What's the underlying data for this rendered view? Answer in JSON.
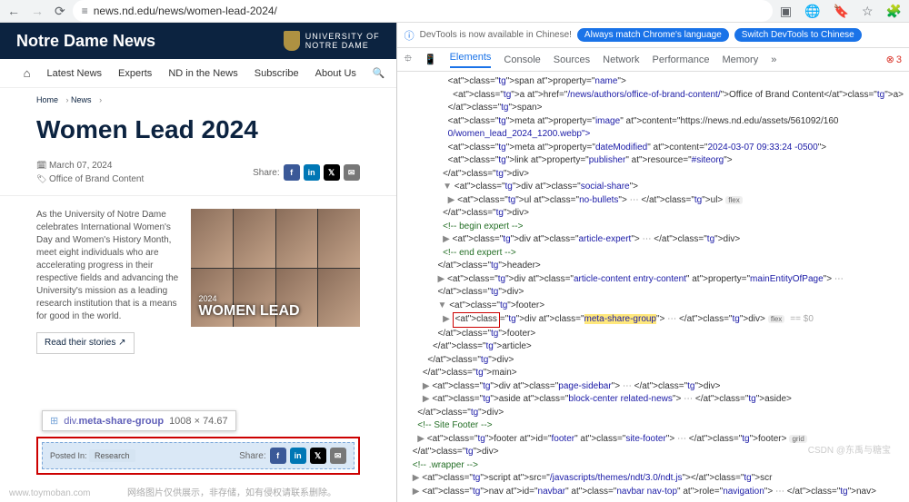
{
  "browser": {
    "url_prefix": "≡",
    "url": "news.nd.edu/news/women-lead-2024/",
    "icons": [
      "chromecast",
      "translate",
      "bookmark",
      "star",
      "ext"
    ]
  },
  "devtools_banner": {
    "info_icon": "ⓘ",
    "info_text": "DevTools is now available in Chinese!",
    "pill1": "Always match Chrome's language",
    "pill2": "Switch DevTools to Chinese"
  },
  "devtools_tabs": {
    "items": [
      "Elements",
      "Console",
      "Sources",
      "Network",
      "Performance",
      "Memory"
    ],
    "more": "»",
    "errors": "3"
  },
  "site": {
    "title": "Notre Dame News",
    "brand_top": "UNIVERSITY OF",
    "brand_bottom": "NOTRE DAME",
    "nav": {
      "home": "⌂",
      "latest": "Latest News",
      "experts": "Experts",
      "ndnews": "ND in the News",
      "subscribe": "Subscribe",
      "about": "About Us",
      "search": "🔍"
    }
  },
  "breadcrumb": {
    "home": "Home",
    "sep1": "›",
    "news": "News",
    "sep2": "›"
  },
  "article": {
    "title": "Women Lead 2024",
    "date": "March 07, 2024",
    "author": "Office of Brand Content",
    "share_label": "Share:",
    "share_icons": {
      "fb": "f",
      "li": "in",
      "x": "𝕏",
      "em": "✉"
    },
    "intro": "As the University of Notre Dame celebrates International Women's Day and Women's History Month, meet eight individuals who are accelerating progress in their respective fields and advancing the University's mission as a leading research institution that is a means for good in the world.",
    "read_btn": "Read their stories ↗",
    "hero_year": "2024",
    "hero_text": "WOMEN LEAD"
  },
  "tooltip": {
    "icon": "⊞",
    "selector_prefix": "div.",
    "selector_class": "meta-share-group",
    "dims": "1008 × 74.67"
  },
  "highlight": {
    "posted_label": "Posted In:",
    "tag": "Research",
    "share_label": "Share:"
  },
  "dom_lines": [
    {
      "i": 9,
      "h": "<span property=\"name\">"
    },
    {
      "i": 10,
      "h": "<a href=\"/news/authors/office-of-brand-content/\">Office of Brand Content</a>"
    },
    {
      "i": 9,
      "h": "</span>"
    },
    {
      "i": 9,
      "h": "<meta property=\"image\" content=\"https://news.nd.edu/assets/561092/160"
    },
    {
      "i": 9,
      "raw": "0/women_lead_2024_1200.webp\">"
    },
    {
      "i": 9,
      "h": "<meta property=\"dateModified\" content=\"2024-03-07 09:33:24 -0500\">"
    },
    {
      "i": 9,
      "h": "<link property=\"publisher\" resource=\"#siteorg\">"
    },
    {
      "i": 8,
      "h": "</div>"
    },
    {
      "i": 8,
      "t": "▼",
      "h": "<div class=\"social-share\">"
    },
    {
      "i": 9,
      "t": "▶",
      "h": "<ul class=\"no-bullets\"> ⋯ </ul>",
      "badge": "flex"
    },
    {
      "i": 8,
      "h": "</div>"
    },
    {
      "i": 8,
      "cm": "<!-- begin expert -->"
    },
    {
      "i": 8,
      "t": "▶",
      "h": "<div class=\"article-expert\"> ⋯ </div>"
    },
    {
      "i": 8,
      "cm": "<!-- end expert -->"
    },
    {
      "i": 7,
      "h": "</header>"
    },
    {
      "i": 7,
      "t": "▶",
      "h": "<div class=\"article-content entry-content\" property=\"mainEntityOfPage\"> ⋯"
    },
    {
      "i": 7,
      "h": "</div>"
    },
    {
      "i": 7,
      "t": "▼",
      "h": "<footer>"
    },
    {
      "i": 8,
      "sel": true,
      "t": "▶",
      "h": "<div class=\"meta-share-group\"> ⋯ </div>",
      "badge": "flex",
      "dollar": "== $0"
    },
    {
      "i": 7,
      "h": "</footer>"
    },
    {
      "i": 6,
      "h": "</article>"
    },
    {
      "i": 5,
      "h": "</div>"
    },
    {
      "i": 4,
      "h": "</main>"
    },
    {
      "i": 4,
      "t": "▶",
      "h": "<div class=\"page-sidebar\"> ⋯ </div>"
    },
    {
      "i": 4,
      "t": "▶",
      "h": "<aside class=\"block-center related-news\"> ⋯ </aside>"
    },
    {
      "i": 3,
      "h": "</div>"
    },
    {
      "i": 3,
      "cm": "<!-- Site Footer -->"
    },
    {
      "i": 3,
      "t": "▶",
      "h": "<footer id=\"footer\" class=\"site-footer\"> ⋯ </footer>",
      "badge": "grid"
    },
    {
      "i": 2,
      "h": "</div>"
    },
    {
      "i": 2,
      "cm": "<!-- .wrapper -->"
    },
    {
      "i": 2,
      "t": "▶",
      "h": "<script src=\"/javascripts/themes/ndt/3.0/ndt.js\"></scr"
    },
    {
      "i": 2,
      "t": "▶",
      "h": "<nav id=\"navbar\" class=\"navbar nav-top\" role=\"navigation\"> ⋯ </nav>"
    }
  ],
  "watermark1": "www.toymoban.com",
  "watermark2": "网络图片仅供展示，非存储，如有侵权请联系删除。",
  "csdn": "CSDN @东禹与糖宝"
}
